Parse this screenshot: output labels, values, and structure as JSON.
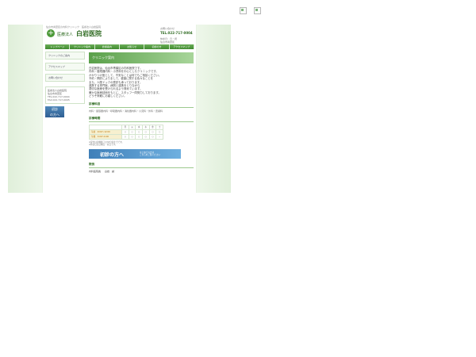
{
  "header": {
    "tagline": "仙台市青葉区の内科クリニック　医療法人白岩医院",
    "brand_small": "医療法人",
    "brand_big": "白岩医院",
    "contact_label": "お問い合わせ",
    "tel": "TEL.022-717-0004",
    "hours": "休診日：日・祝",
    "address": "仙台市青葉区"
  },
  "nav": {
    "items": [
      "トップページ",
      "クリニック案内",
      "診療案内",
      "お知らせ",
      "初診の方",
      "アクセスマップ"
    ]
  },
  "sidebar": {
    "items": [
      "クリニックのご案内",
      "アクセスマップ",
      "お問い合わせ"
    ],
    "info_lines": [
      "医療法人白岩医院",
      "仙台市青葉区",
      "TEL.022-717-0004",
      "FAX.022-717-0005"
    ],
    "banner_label": [
      "初診",
      "の方へ"
    ]
  },
  "main": {
    "hero_title": "クリニック案内",
    "intro_lines": [
      "白岩医院は、仙台市青葉区の内科医院です。",
      "内科・循環器内科・小児科を中心としたクリニックです。",
      "かかりつけ医として、不安なことは何でもご相談ください。",
      "予約・問診によりまして、健康に関する色々なことを",
      "また、人間ドックの受診も承っております。",
      "連携する専門医、病院と連携をとりながら",
      "適切な医療を受けられるよう努めています。",
      "確かな医療技術をもとに、スタッフ一同努力しております。",
      "どうぞ気軽にお越しください。"
    ],
    "dept_heading": "診療科目",
    "dept_text": "内科・循環器内科・呼吸器内科・消化器内科・小児科・外科・皮膚科",
    "hours_heading": "診療時間",
    "schedule": {
      "days": [
        "月",
        "火",
        "水",
        "木",
        "金",
        "土"
      ],
      "rows": [
        {
          "label": "午前　9:00～12:00",
          "marks": [
            "○",
            "○",
            "○",
            "○",
            "○",
            "○"
          ]
        },
        {
          "label": "午後　3:00～6:00",
          "marks": [
            "○",
            "○",
            "○",
            "○",
            "○",
            "－"
          ]
        }
      ]
    },
    "notes": [
      "※受付は診療終了の30分前までです。",
      "※休診日は日曜日・祝日です。"
    ],
    "banner_title": "初診の方へ",
    "banner_sub": [
      "はじめての方は",
      "こちらをご覧ください"
    ],
    "staff_heading": "院長",
    "staff_role": "内科医院長",
    "staff_name": "白岩　誠"
  }
}
